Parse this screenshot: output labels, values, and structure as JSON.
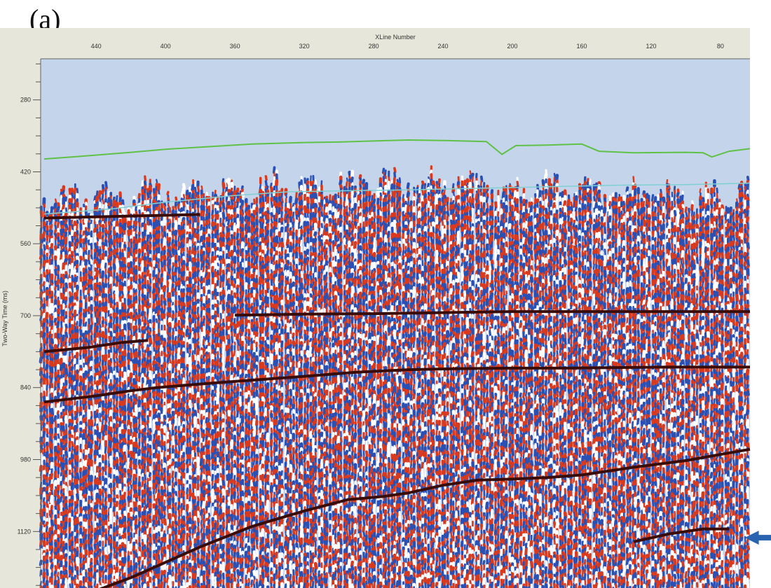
{
  "panel_label": "(a)",
  "chart_data": {
    "type": "seismic-section",
    "title": "",
    "xlabel": "XLine Number",
    "ylabel": "Two-Way Time (ms)",
    "x_ticks": [
      440,
      400,
      360,
      320,
      280,
      240,
      200,
      160,
      120,
      80
    ],
    "y_ticks": [
      280,
      420,
      560,
      700,
      840,
      980,
      1120
    ],
    "xlim": [
      472,
      63
    ],
    "ylim": [
      200,
      1230
    ],
    "grid": false,
    "legend": "none",
    "colors": {
      "background": "#c4d4ea",
      "frame": "#e6e6da",
      "positive_amplitude": "#d93a1e",
      "negative_amplitude": "#2a50b4",
      "strong_reflector": "#3a0c06",
      "green_horizon": "#5fc247",
      "cyan_horizon": "#7ed0d4",
      "arrow": "#2a63b0"
    },
    "horizons": [
      {
        "color_key": "green_horizon",
        "points": [
          [
            470,
            395
          ],
          [
            450,
            390
          ],
          [
            420,
            382
          ],
          [
            400,
            376
          ],
          [
            380,
            372
          ],
          [
            350,
            366
          ],
          [
            320,
            363
          ],
          [
            300,
            362
          ],
          [
            280,
            360
          ],
          [
            260,
            358
          ],
          [
            240,
            359
          ],
          [
            215,
            361
          ],
          [
            206,
            386
          ],
          [
            198,
            369
          ],
          [
            180,
            368
          ],
          [
            160,
            366
          ],
          [
            150,
            380
          ],
          [
            130,
            383
          ],
          [
            100,
            382
          ],
          [
            90,
            383
          ],
          [
            85,
            391
          ],
          [
            75,
            380
          ],
          [
            63,
            375
          ]
        ]
      },
      {
        "color_key": "cyan_horizon",
        "points": [
          [
            470,
            502
          ],
          [
            430,
            492
          ],
          [
            400,
            479
          ],
          [
            360,
            466
          ],
          [
            330,
            459
          ],
          [
            300,
            457
          ],
          [
            260,
            455
          ],
          [
            220,
            452
          ],
          [
            180,
            449
          ],
          [
            140,
            446
          ],
          [
            100,
            445
          ],
          [
            63,
            442
          ]
        ]
      }
    ],
    "reflectors": [
      [
        [
          470,
          1270
        ],
        [
          440,
          1235
        ],
        [
          420,
          1210
        ],
        [
          400,
          1180
        ],
        [
          380,
          1150
        ],
        [
          350,
          1110
        ],
        [
          320,
          1080
        ],
        [
          295,
          1058
        ],
        [
          275,
          1052
        ],
        [
          260,
          1045
        ],
        [
          240,
          1030
        ],
        [
          220,
          1020
        ],
        [
          200,
          1018
        ],
        [
          180,
          1015
        ],
        [
          160,
          1010
        ],
        [
          130,
          995
        ],
        [
          100,
          982
        ],
        [
          80,
          970
        ],
        [
          63,
          960
        ]
      ],
      [
        [
          470,
          868
        ],
        [
          440,
          856
        ],
        [
          420,
          846
        ],
        [
          405,
          840
        ],
        [
          380,
          833
        ],
        [
          360,
          828
        ],
        [
          320,
          818
        ],
        [
          290,
          810
        ],
        [
          260,
          805
        ],
        [
          230,
          803
        ],
        [
          200,
          802
        ],
        [
          170,
          802
        ],
        [
          140,
          801
        ],
        [
          110,
          800
        ],
        [
          63,
          800
        ]
      ],
      [
        [
          470,
          770
        ],
        [
          445,
          762
        ],
        [
          425,
          752
        ],
        [
          410,
          748
        ]
      ],
      [
        [
          360,
          699
        ],
        [
          320,
          697
        ],
        [
          280,
          696
        ],
        [
          240,
          694
        ],
        [
          200,
          692
        ],
        [
          160,
          692
        ],
        [
          120,
          692
        ],
        [
          63,
          692
        ]
      ],
      [
        [
          130,
          1140
        ],
        [
          110,
          1125
        ],
        [
          90,
          1115
        ],
        [
          75,
          1115
        ]
      ],
      [
        [
          470,
          510
        ],
        [
          420,
          506
        ],
        [
          380,
          503
        ]
      ]
    ],
    "arrow_target": {
      "x": 66,
      "y": 1132
    }
  }
}
